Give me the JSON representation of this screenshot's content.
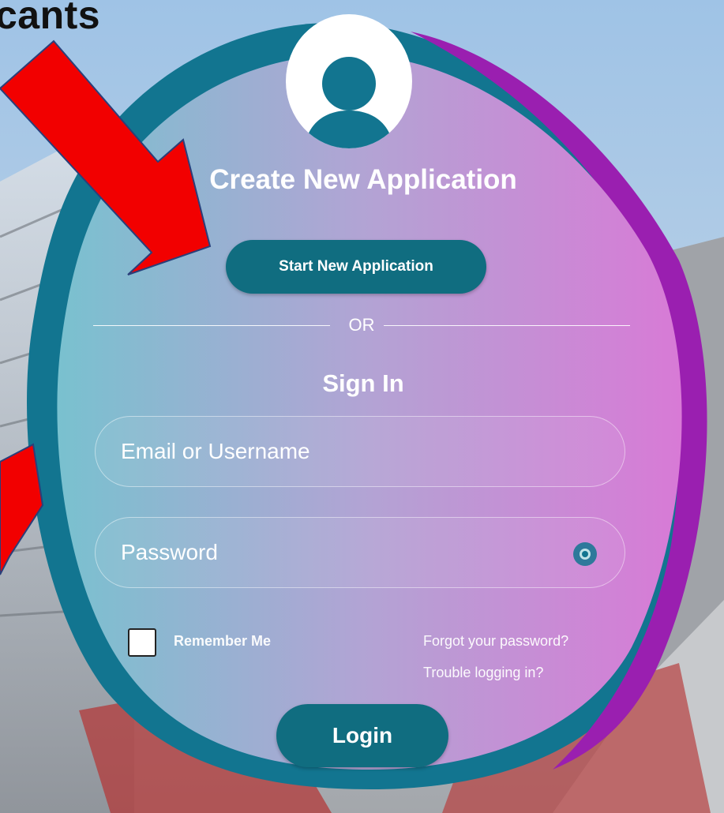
{
  "heading_fragment": "cants",
  "panel": {
    "title": "Create New Application",
    "start_button": "Start New Application",
    "divider_text": "OR",
    "signin_title": "Sign In",
    "email_placeholder": "Email or Username",
    "password_placeholder": "Password",
    "remember_label": "Remember Me",
    "forgot_link": "Forgot your password?",
    "trouble_link": "Trouble logging in?",
    "login_button": "Login"
  },
  "icons": {
    "avatar": "user-avatar-icon",
    "password_toggle": "eye-icon",
    "arrows": "red-arrow-annotation"
  },
  "colors": {
    "teal": "#106d80",
    "pink": "#d57ad4",
    "purple": "#9a1fb0",
    "arrow_red": "#f20000"
  }
}
